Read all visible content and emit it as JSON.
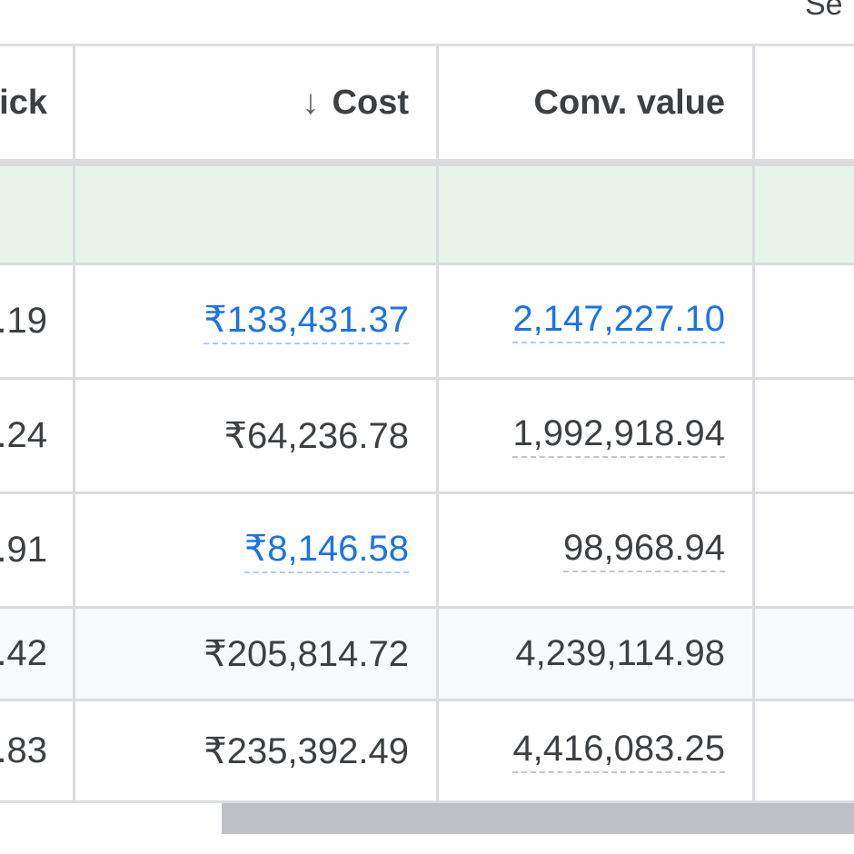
{
  "top_label": "Se",
  "table": {
    "columns": [
      {
        "label": "ick"
      },
      {
        "label": "Cost",
        "sort_icon": "arrow-down-icon"
      },
      {
        "label": "Conv. value"
      },
      {
        "label": ""
      }
    ],
    "rows": [
      {
        "c0": ".19",
        "cost": "₹133,431.37",
        "conv_value": "2,147,227.10"
      },
      {
        "c0": ".24",
        "cost": "₹64,236.78",
        "conv_value": "1,992,918.94"
      },
      {
        "c0": ".91",
        "cost": "₹8,146.58",
        "conv_value": "98,968.94"
      },
      {
        "c0": ".42",
        "cost": "₹205,814.72",
        "conv_value": "4,239,114.98"
      },
      {
        "c0": ".83",
        "cost": "₹235,392.49",
        "conv_value": "4,416,083.25"
      }
    ]
  },
  "colors": {
    "link": "#1a73e8",
    "total_bar": "#e6f4ea",
    "grid": "#dadce0",
    "scrollbar": "#bdc1c6"
  }
}
